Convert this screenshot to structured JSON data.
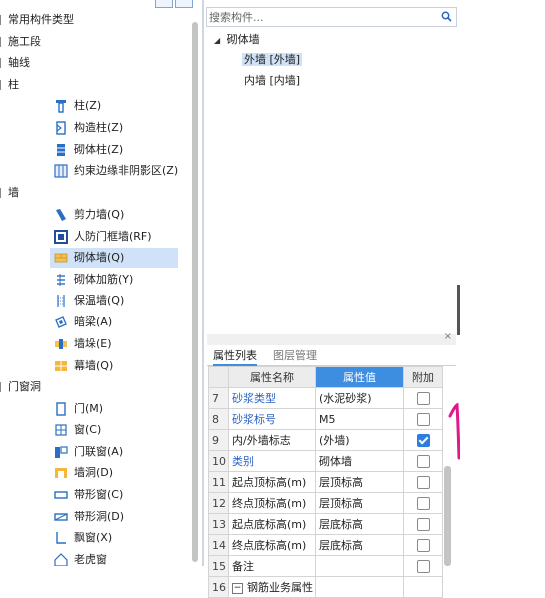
{
  "tree": {
    "categories": {
      "common": "常用构件类型",
      "construction": "施工段",
      "axis": "轴线",
      "column": "柱",
      "wall": "墙",
      "door_window": "门窗洞"
    },
    "column_items": [
      "柱(Z)",
      "构造柱(Z)",
      "砌体柱(Z)",
      "约束边缘非阴影区(Z)"
    ],
    "wall_items": [
      "剪力墙(Q)",
      "人防门框墙(RF)",
      "砌体墙(Q)",
      "砌体加筋(Y)",
      "保温墙(Q)",
      "暗梁(A)",
      "墙垛(E)",
      "幕墙(Q)"
    ],
    "door_items": [
      "门(M)",
      "窗(C)",
      "门联窗(A)",
      "墙洞(D)",
      "带形窗(C)",
      "带形洞(D)",
      "飘窗(X)",
      "老虎窗"
    ]
  },
  "search": {
    "placeholder": "搜索构件..."
  },
  "component_tree": {
    "root": "砌体墙",
    "children": [
      "外墙 [外墙]",
      "内墙 [内墙]"
    ]
  },
  "properties": {
    "tab_active": "属性列表",
    "tab_inactive": "图层管理",
    "columns": {
      "name": "属性名称",
      "value": "属性值",
      "extra": "附加"
    },
    "rows": [
      {
        "num": "7",
        "name": "砂浆类型",
        "value": "(水泥砂浆)",
        "checked": false,
        "link": true
      },
      {
        "num": "8",
        "name": "砂浆标号",
        "value": "M5",
        "checked": false,
        "link": true
      },
      {
        "num": "9",
        "name": "内/外墙标志",
        "value": "(外墙)",
        "checked": true,
        "link": false
      },
      {
        "num": "10",
        "name": "类别",
        "value": "砌体墙",
        "checked": false,
        "link": true
      },
      {
        "num": "11",
        "name": "起点顶标高(m)",
        "value": "层顶标高",
        "checked": false,
        "link": false
      },
      {
        "num": "12",
        "name": "终点顶标高(m)",
        "value": "层顶标高",
        "checked": false,
        "link": false
      },
      {
        "num": "13",
        "name": "起点底标高(m)",
        "value": "层底标高",
        "checked": false,
        "link": false
      },
      {
        "num": "14",
        "name": "终点底标高(m)",
        "value": "层底标高",
        "checked": false,
        "link": false
      },
      {
        "num": "15",
        "name": "备注",
        "value": "",
        "checked": false,
        "link": false
      },
      {
        "num": "16",
        "name": "钢筋业务属性",
        "value": "",
        "checked": null,
        "link": false
      }
    ]
  },
  "icons": {
    "column": "column-icon",
    "struct_column": "structural-column-icon",
    "masonry_column": "masonry-column-icon",
    "boundary": "boundary-zone-icon",
    "shear_wall": "shear-wall-icon",
    "door_frame_wall": "door-frame-wall-icon",
    "masonry_wall": "masonry-wall-icon",
    "reinforcement": "reinforcement-icon",
    "insulation_wall": "insulation-wall-icon",
    "hidden_beam": "hidden-beam-icon",
    "wall_pier": "wall-pier-icon",
    "curtain_wall": "curtain-wall-icon",
    "search": "search-icon",
    "collapse": "collapse-triangle-icon",
    "close": "close-icon"
  },
  "colors": {
    "accent": "#3d8de0",
    "selection": "#cfe2f7",
    "link": "#2a63c4",
    "annotation": "#e0188a"
  }
}
